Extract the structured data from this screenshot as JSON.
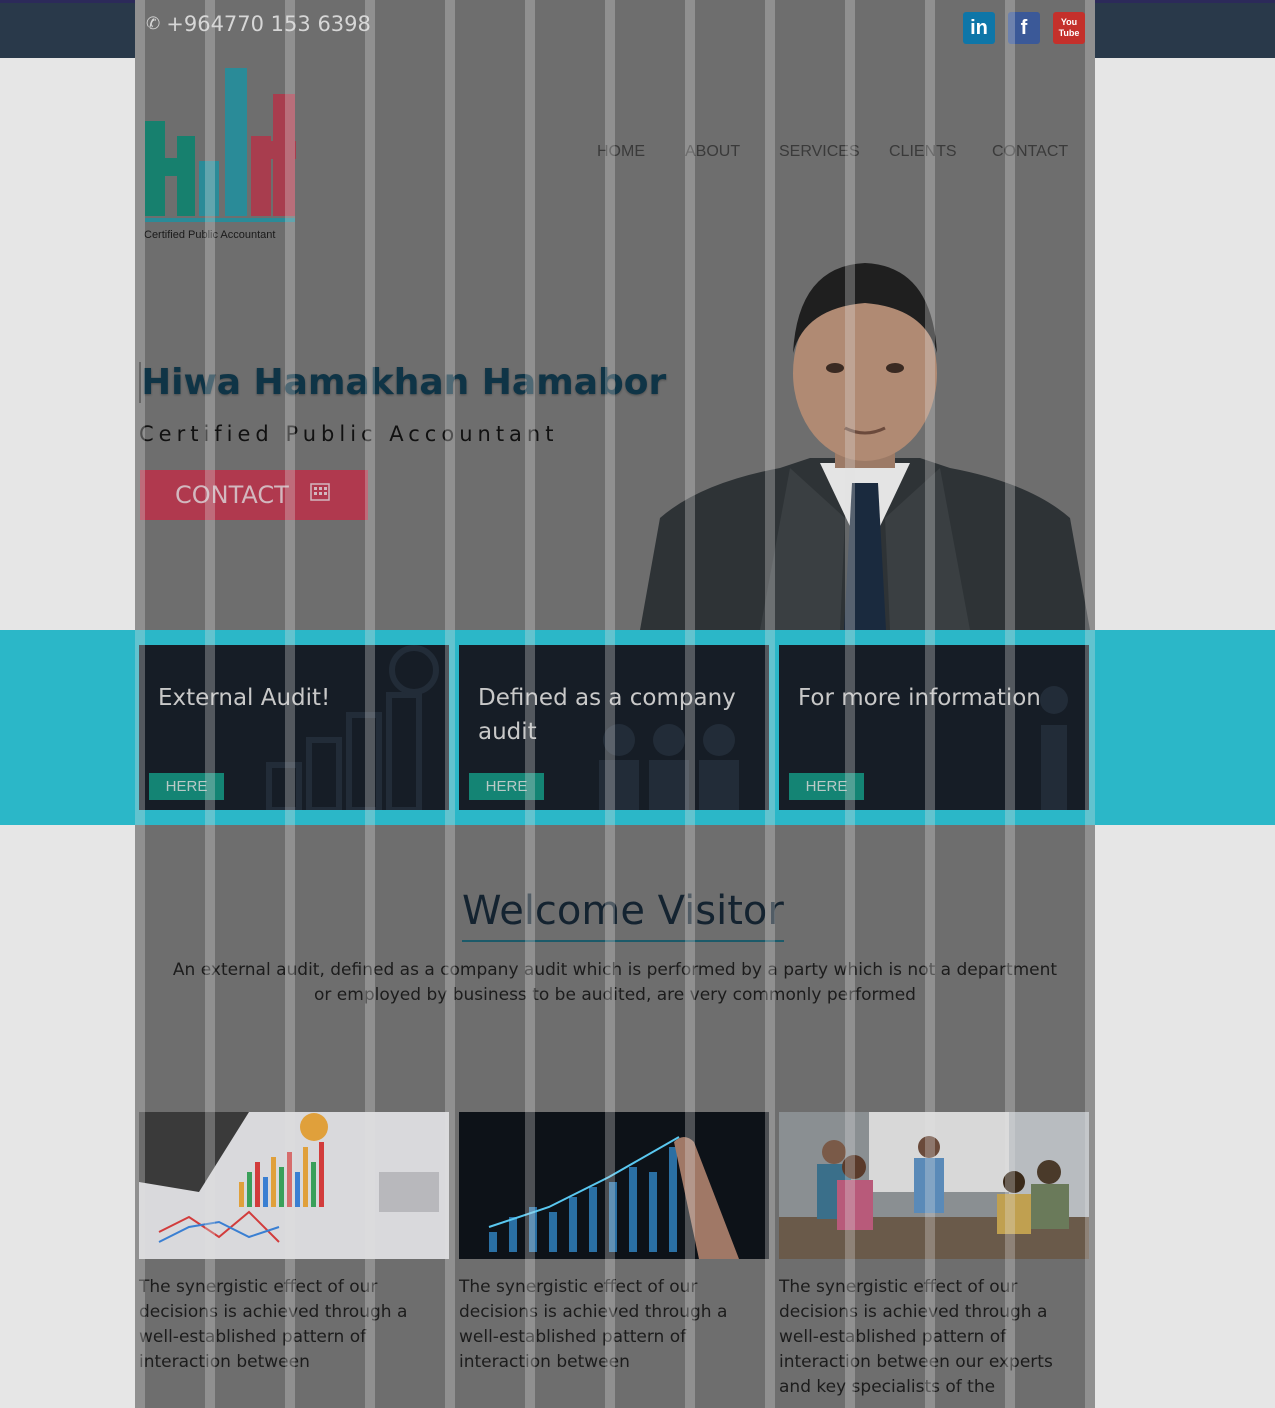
{
  "topbar": {
    "phone": "+964770 153 6398",
    "social": [
      {
        "name": "linkedin-icon",
        "label": "in"
      },
      {
        "name": "facebook-icon",
        "label": "f"
      },
      {
        "name": "youtube-icon",
        "label": "You Tube"
      }
    ]
  },
  "logo": {
    "caption": "Certified Public Accountant"
  },
  "nav": {
    "items": [
      "HOME",
      "ABOUT",
      "SERVICES",
      "CLIENTS",
      "CONTACT"
    ]
  },
  "hero": {
    "name": "Hiwa Hamakhan Hamabor",
    "subtitle": "Certified Public Accountant",
    "button": "CONTACT"
  },
  "cards": [
    {
      "title": "External Audit!",
      "button": "HERE"
    },
    {
      "title": "Defined as a company audit",
      "button": "HERE"
    },
    {
      "title": "For more information",
      "button": "HERE"
    }
  ],
  "welcome": {
    "title": "Welcome Visitor",
    "text": "An external audit, defined as a company audit which is performed by a party which is not a department or employed by business to be audited, are very commonly performed"
  },
  "features": [
    {
      "text": "The synergistic effect of our decisions is achieved through a well-established pattern of interaction between"
    },
    {
      "text": "The synergistic effect of our decisions is achieved through a well-established pattern of interaction between"
    },
    {
      "text": "The synergistic effect of our decisions is achieved through a well-established pattern of interaction between our experts and key specialists of the"
    }
  ],
  "colors": {
    "topbar": "#29394a",
    "accent_teal": "#2bb7c8",
    "button_red": "#b0394e",
    "button_green": "#148474",
    "card_bg": "#161d26"
  }
}
